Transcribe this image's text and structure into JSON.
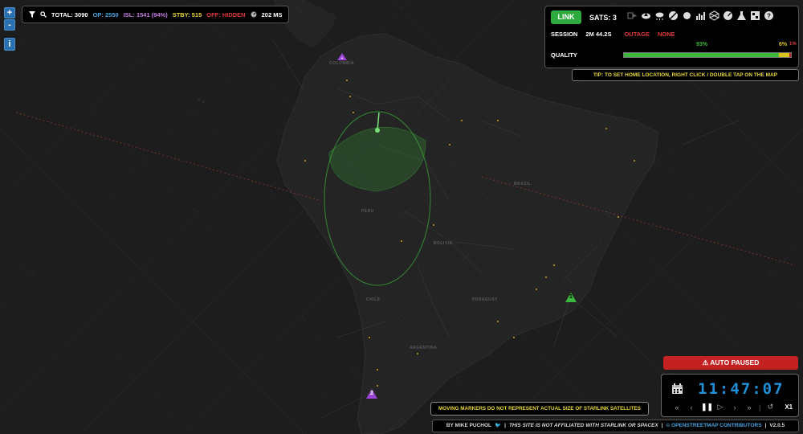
{
  "stats": {
    "filter_icon": "filter-icon",
    "search_icon": "search-icon",
    "total": "TOTAL: 3090",
    "op": "OP: 2550",
    "isl": "ISL: 1541 (94%)",
    "stby": "STBY: 515",
    "off": "OFF: HIDDEN",
    "latency": "202 MS",
    "colors": {
      "total": "#ffffff",
      "op": "#4aa3e0",
      "isl": "#c77be6",
      "stby": "#e9d83a",
      "off": "#e03a3a"
    }
  },
  "zoom": {
    "in": "+",
    "out": "-"
  },
  "info": "i",
  "panel": {
    "link_label": "LINK",
    "sats_label": "SATS: 3",
    "icons": [
      "sign-out-icon",
      "cloud-upload-icon",
      "weather-icon",
      "satellite-icon",
      "sun-icon",
      "chart-icon",
      "network-icon",
      "gauge-icon",
      "flask-icon",
      "calculator-icon",
      "help-icon"
    ],
    "session_label": "SESSION",
    "session_value": "2M 44.2S",
    "outage_label": "OUTAGE",
    "outage_value": "NONE",
    "quality_label": "QUALITY",
    "quality_green_pct": "93%",
    "quality_yellow_pct": "6%",
    "quality_red_pct": "1%",
    "quality_values": {
      "green": 93,
      "yellow": 6,
      "red": 1
    }
  },
  "tip": "TIP: TO SET HOME LOCATION, RIGHT CLICK / DOUBLE TAP ON THE MAP",
  "auto_paused": "AUTO PAUSED",
  "clock": {
    "time": "11:47:07",
    "speed": "X1"
  },
  "notice": "MOVING MARKERS DO NOT REPRESENT ACTUAL SIZE OF STARLINK SATELLITES",
  "footer": {
    "author": "BY MIKE PUCHOL",
    "disclaimer": "THIS SITE IS NOT AFFILIATED WITH STARLINK OR SPACEX",
    "osm": "© OPENSTREETMAP CONTRIBUTORS",
    "version": "V2.0.5",
    "sep": "|"
  },
  "markers": {
    "ground_station_1": "1",
    "ground_station_2": "2"
  },
  "map_labels": [
    "COLOMBIA",
    "PERU",
    "BRAZIL",
    "BOLIVIA",
    "PARAGUAY",
    "CHILE",
    "ARGENTINA"
  ],
  "colors": {
    "accent_green": "#2eab3f",
    "map_bg": "#1d1d1d",
    "coverage": "#3bb83b"
  }
}
